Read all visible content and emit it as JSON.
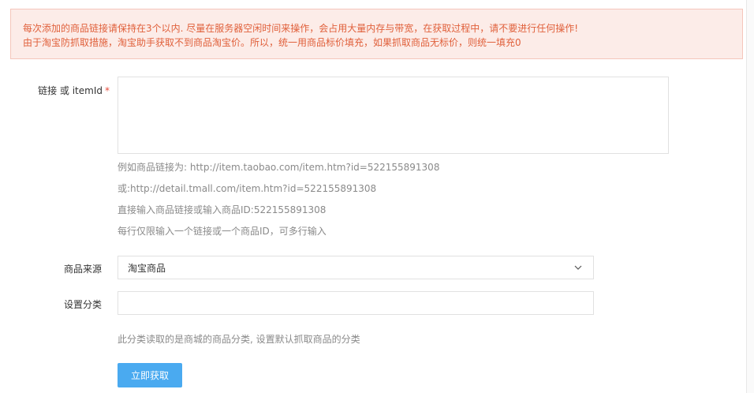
{
  "notice": {
    "line1": "每次添加的商品链接请保持在3个以内. 尽量在服务器空闲时间来操作，会占用大量内存与带宽，在获取过程中，请不要进行任何操作!",
    "line2": "由于淘宝防抓取措施，淘宝助手获取不到商品淘宝价。所以，统一用商品标价填充，如果抓取商品无标价，则统一填充0"
  },
  "form": {
    "link_field": {
      "label": "链接 或 itemId",
      "required_mark": "*",
      "value": "",
      "hints": [
        "例如商品链接为: http://item.taobao.com/item.htm?id=522155891308",
        "或:http://detail.tmall.com/item.htm?id=522155891308",
        "直接输入商品链接或输入商品ID:522155891308",
        "每行仅限输入一个链接或一个商品ID，可多行输入"
      ]
    },
    "source_field": {
      "label": "商品来源",
      "selected": "淘宝商品",
      "icon": "chevron-down-icon"
    },
    "category_field": {
      "label": "设置分类",
      "value": "",
      "hint": "此分类读取的是商城的商品分类, 设置默认抓取商品的分类"
    },
    "submit_label": "立即获取"
  },
  "colors": {
    "alert_bg": "#fcece8",
    "alert_text": "#e0603b",
    "primary_button": "#4aaaf0",
    "required": "#e74c3c"
  }
}
